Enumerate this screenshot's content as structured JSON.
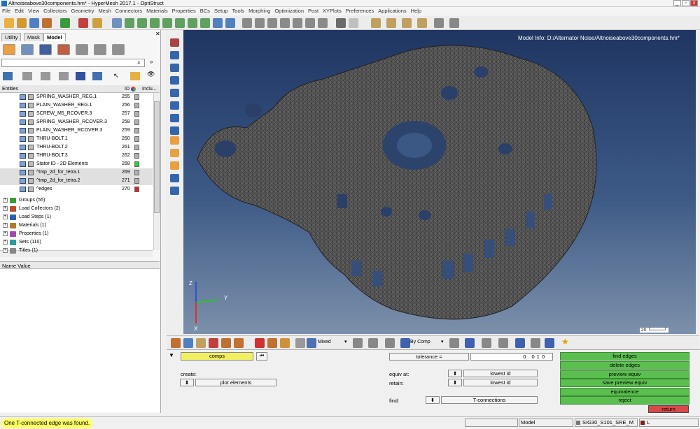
{
  "window": {
    "title": "Altnoiseabove30components.hm* - HyperMesh 2017.1 - OptiStruct"
  },
  "menu": [
    "File",
    "Edit",
    "View",
    "Collectors",
    "Geometry",
    "Mesh",
    "Connectors",
    "Materials",
    "Properties",
    "BCs",
    "Setup",
    "Tools",
    "Morphing",
    "Optimization",
    "Post",
    "XYPlots",
    "Preferences",
    "Applications",
    "Help"
  ],
  "tabs": [
    "Utility",
    "Mask",
    "Model"
  ],
  "entities_header": {
    "entities": "Entities",
    "id": "ID",
    "include": "Inclu..."
  },
  "rows": [
    {
      "name": "SPRING_WASHER_REG.1",
      "id": "255",
      "swatch": "#b0b0b0"
    },
    {
      "name": "PLAIN_WASHER_REG.1",
      "id": "256",
      "swatch": "#b0b0b0"
    },
    {
      "name": "SCREW_M5_RCOVER.3",
      "id": "257",
      "swatch": "#b0b0b0"
    },
    {
      "name": "SPRING_WASHER_RCOVER.3",
      "id": "258",
      "swatch": "#b0b0b0"
    },
    {
      "name": "PLAIN_WASHER_RCOVER.3",
      "id": "259",
      "swatch": "#b0b0b0"
    },
    {
      "name": "THRU-BOLT.1",
      "id": "260",
      "swatch": "#b0b0b0"
    },
    {
      "name": "THRU-BOLT.2",
      "id": "261",
      "swatch": "#b0b0b0"
    },
    {
      "name": "THRU-BOLT.3",
      "id": "262",
      "swatch": "#b0b0b0"
    },
    {
      "name": "Stator ID - 2D Elements",
      "id": "268",
      "swatch": "#33cc33"
    },
    {
      "name": "^tmp_2d_for_tetra.1",
      "id": "269",
      "swatch": "#b0b0b0"
    },
    {
      "name": "^tmp_2d_for_tetra.2",
      "id": "271",
      "swatch": "#b0b0b0"
    },
    {
      "name": "^edges",
      "id": "270",
      "swatch": "#dd2222"
    }
  ],
  "groups": [
    {
      "label": "Groups (55)",
      "color": "#3a9a3a"
    },
    {
      "label": "Load Collectors (2)",
      "color": "#c04a2a"
    },
    {
      "label": "Load Steps (1)",
      "color": "#2a60b0"
    },
    {
      "label": "Materials (1)",
      "color": "#b07a2a"
    },
    {
      "label": "Properties (1)",
      "color": "#a04ab0"
    },
    {
      "label": "Sets (110)",
      "color": "#2a9a9a"
    },
    {
      "label": "Titles (1)",
      "color": "#888888"
    }
  ],
  "name_value_header": "Name Value",
  "model_info": "Model Info: D:/Alternator Noise/Altnoiseabove30components.hm*",
  "scale_label": "20",
  "axis": {
    "x": "X",
    "y": "Y",
    "z": "Z"
  },
  "bottom_toolbar": {
    "mixed": "Mixed",
    "bycomp": "By Comp"
  },
  "panel": {
    "comps": "comps",
    "create_label": "create:",
    "create_value": "plot elements",
    "tolerance_label": "tolerance =",
    "tolerance_value": "0.010",
    "equiv_at_label": "equiv at:",
    "equiv_at_value": "lowest id",
    "retain_label": "retain:",
    "retain_value": "lowest id",
    "find_label": "find:",
    "find_value": "T-connections",
    "buttons": [
      "find edges",
      "delete edges",
      "preview equiv",
      "save preview equiv",
      "equivalence",
      "reject"
    ],
    "return": "return"
  },
  "status": {
    "message": "One T-connected edge was found.",
    "model": "Model",
    "component": "SIG30_S101_SRE_M",
    "last": "L"
  }
}
